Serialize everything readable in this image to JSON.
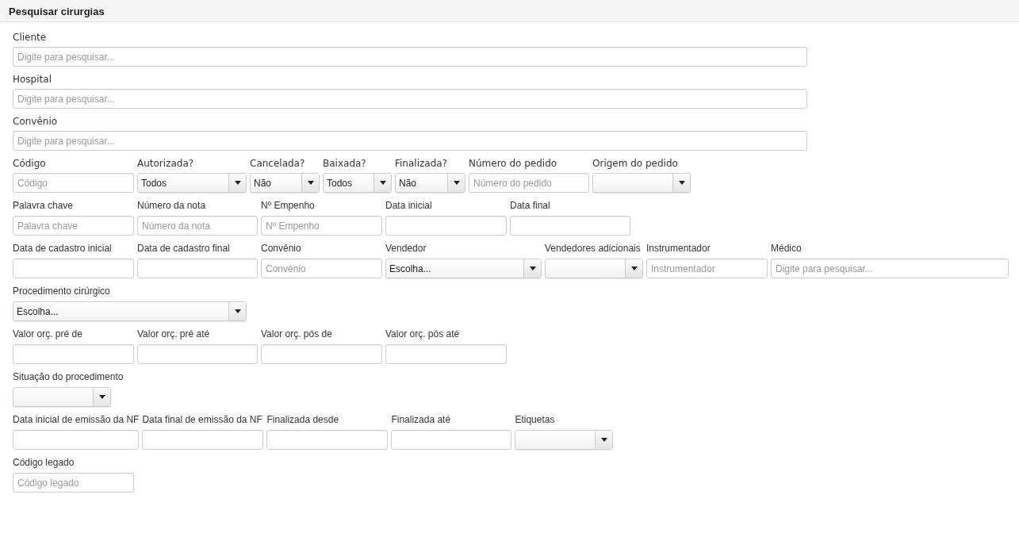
{
  "panel": {
    "title": "Pesquisar cirurgias"
  },
  "rows": [
    [
      {
        "label": "Cliente",
        "kind": "text",
        "placeholder": "Digite para pesquisar..."
      }
    ],
    [
      {
        "label": "Hospital",
        "kind": "text",
        "placeholder": "Digite para pesquisar..."
      }
    ],
    [
      {
        "label": "Convênio",
        "kind": "text",
        "placeholder": "Digite para pesquisar..."
      }
    ],
    [
      {
        "label": "Código",
        "kind": "text",
        "placeholder": "Código"
      },
      {
        "label": "Autorizada?",
        "kind": "select",
        "value": "Todos"
      },
      {
        "label": "Cancelada?",
        "kind": "select",
        "value": "Não"
      },
      {
        "label": "Baixada?",
        "kind": "select",
        "value": "Todos"
      },
      {
        "label": "Finalizada?",
        "kind": "select",
        "value": "Não"
      },
      {
        "label": "Número do pedido",
        "kind": "text",
        "placeholder": "Número do pedido"
      },
      {
        "label": "Origem do pedido",
        "kind": "select"
      }
    ],
    [
      {
        "label": "Palavra chave",
        "kind": "text",
        "placeholder": "Palavra chave"
      },
      {
        "label": "Número da nota",
        "kind": "text",
        "placeholder": "Número da nota"
      },
      {
        "label": "Nº Empenho",
        "kind": "text",
        "placeholder": "Nº Empenho"
      },
      {
        "label": "Data inicial",
        "kind": "text"
      },
      {
        "label": "Data final",
        "kind": "text"
      }
    ],
    [
      {
        "label": "Data de cadastro inicial",
        "kind": "text"
      },
      {
        "label": "Data de cadastro final",
        "kind": "text"
      },
      {
        "label": "Convênio",
        "kind": "text",
        "placeholder": "Convênio"
      },
      {
        "label": "Vendedor",
        "kind": "select",
        "value": "Escolha..."
      },
      {
        "label": "Vendedores adicionais",
        "kind": "select"
      },
      {
        "label": "Instrumentador",
        "kind": "text",
        "placeholder": "Instrumentador"
      },
      {
        "label": "Médico",
        "kind": "text",
        "placeholder": "Digite para pesquisar..."
      }
    ],
    [
      {
        "label": "Procedimento cirúrgico",
        "kind": "select",
        "value": "Escolha..."
      }
    ],
    [
      {
        "label": "Valor orç. pré de",
        "kind": "text"
      },
      {
        "label": "Valor orç. pré até",
        "kind": "text"
      },
      {
        "label": "Valor orç. pós de",
        "kind": "text"
      },
      {
        "label": "Valor orç. pós até",
        "kind": "text"
      }
    ],
    [
      {
        "label": "Situação do procedimento",
        "kind": "select"
      }
    ],
    [
      {
        "label": "Data inicial de emissão da NF",
        "kind": "text"
      },
      {
        "label": "Data final de emissão da NF",
        "kind": "text"
      },
      {
        "label": "Finalizada desde",
        "kind": "text"
      },
      {
        "label": "Finalizada até",
        "kind": "text"
      },
      {
        "label": "Etiquetas",
        "kind": "select"
      }
    ],
    [
      {
        "label": "Código legado",
        "kind": "text",
        "placeholder": "Código legado"
      }
    ]
  ]
}
